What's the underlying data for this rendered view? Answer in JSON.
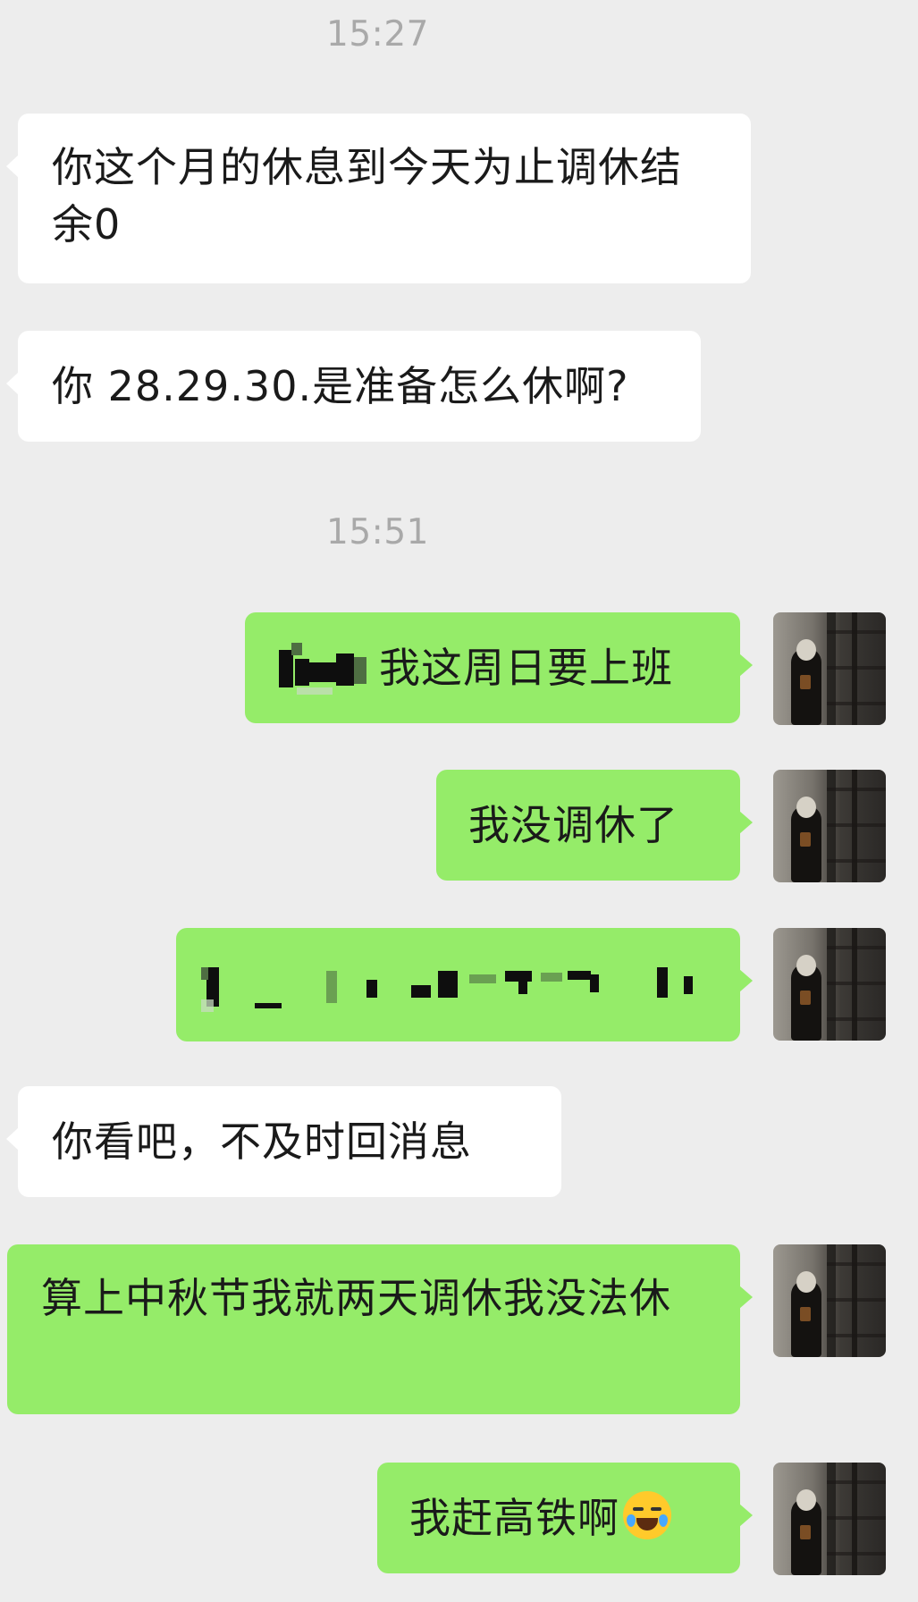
{
  "chat": {
    "timestamps": [
      "15:27",
      "15:51"
    ],
    "messages": [
      {
        "side": "in",
        "text": "你这个月的休息到今天为止调休结余0"
      },
      {
        "side": "in",
        "text": "你 28.29.30.是准备怎么休啊?"
      },
      {
        "side": "out",
        "text": "我这周日要上班",
        "redacted_prefix": true
      },
      {
        "side": "out",
        "text": "我没调休了"
      },
      {
        "side": "out",
        "text": "",
        "redacted": true
      },
      {
        "side": "in",
        "text": "你看吧，不及时回消息"
      },
      {
        "side": "out",
        "text": "算上中秋节我就两天调休我没法休"
      },
      {
        "side": "out",
        "text": "我赶高铁啊",
        "emoji": "loudly-crying-face-icon"
      }
    ]
  },
  "colors": {
    "background": "#ededed",
    "incoming_bubble": "#ffffff",
    "outgoing_bubble": "#95ec69",
    "timestamp": "#a9a9a9"
  }
}
